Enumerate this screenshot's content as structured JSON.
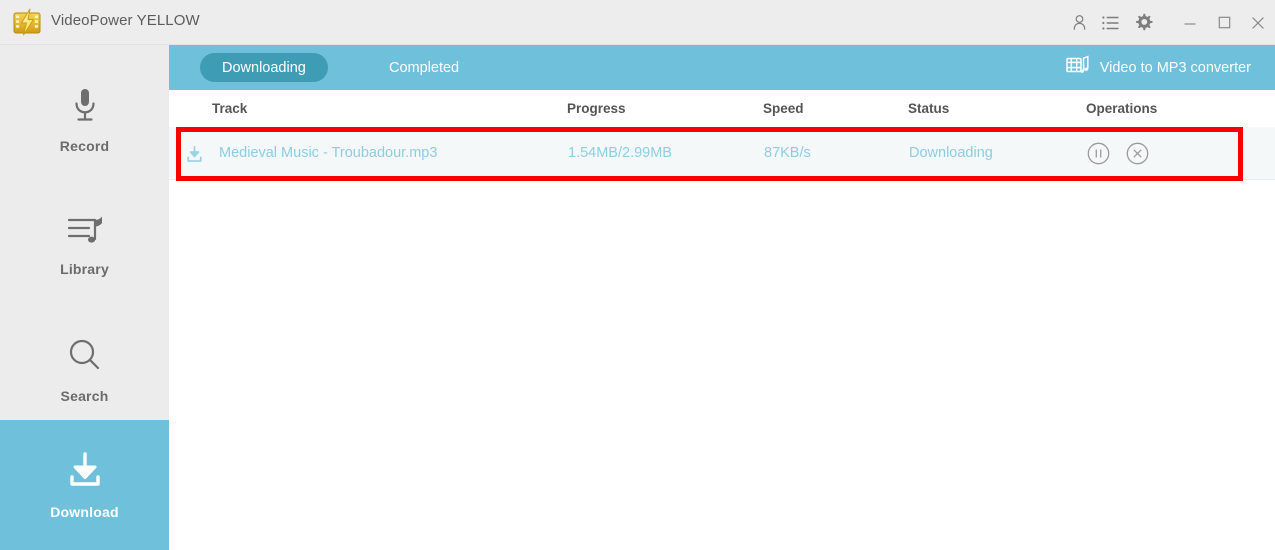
{
  "window": {
    "title": "VideoPower YELLOW",
    "logo_icon": "videopower-logo-icon",
    "titlebar_icons": [
      {
        "name": "account-icon",
        "glyph": "user"
      },
      {
        "name": "list-icon",
        "glyph": "list"
      },
      {
        "name": "settings-gear-icon",
        "glyph": "gear"
      }
    ],
    "controls": [
      {
        "name": "minimize-button",
        "glyph": "minimize"
      },
      {
        "name": "maximize-button",
        "glyph": "maximize"
      },
      {
        "name": "close-button",
        "glyph": "close"
      }
    ]
  },
  "colors": {
    "accent": "#6fc0da",
    "accent_dark": "#3f9cb5",
    "sidebar_bg": "#ececec",
    "row_bg": "#f4f8f9",
    "row_text": "#8ecde3",
    "highlight_box": "#fb0000",
    "titlebar_bg": "#ededed"
  },
  "sidebar": {
    "items": [
      {
        "id": "record",
        "label": "Record",
        "icon": "microphone-icon",
        "active": false
      },
      {
        "id": "library",
        "label": "Library",
        "icon": "playlist-music-icon",
        "active": false
      },
      {
        "id": "search",
        "label": "Search",
        "icon": "magnifier-icon",
        "active": false
      },
      {
        "id": "download",
        "label": "Download",
        "icon": "download-arrow-icon",
        "active": true
      }
    ]
  },
  "tabs": [
    {
      "id": "downloading",
      "label": "Downloading",
      "active": true
    },
    {
      "id": "completed",
      "label": "Completed",
      "active": false
    }
  ],
  "converter": {
    "label": "Video to MP3 converter",
    "icon": "video-to-mp3-icon"
  },
  "table": {
    "columns": [
      {
        "id": "track",
        "label": "Track"
      },
      {
        "id": "progress",
        "label": "Progress"
      },
      {
        "id": "speed",
        "label": "Speed"
      },
      {
        "id": "status",
        "label": "Status"
      },
      {
        "id": "operations",
        "label": "Operations"
      }
    ],
    "rows": [
      {
        "track": "Medieval Music - Troubadour.mp3",
        "progress": "1.54MB/2.99MB",
        "speed": "87KB/s",
        "status": "Downloading",
        "track_icon": "download-item-icon",
        "operations": [
          {
            "name": "pause-button",
            "icon": "pause-circle-icon"
          },
          {
            "name": "cancel-button",
            "icon": "close-circle-icon"
          }
        ]
      }
    ]
  }
}
